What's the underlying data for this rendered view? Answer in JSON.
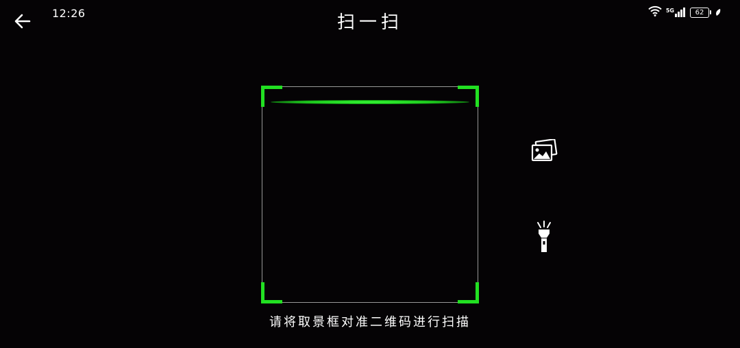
{
  "status_bar": {
    "time": "12:26",
    "network": "5G",
    "battery": "62"
  },
  "header": {
    "title": "扫一扫",
    "back_icon": "arrow-left-icon"
  },
  "scanner": {
    "hint": "请将取景框对准二维码进行扫描",
    "accent_color": "#22e022"
  },
  "actions": {
    "album_icon": "photo-album-icon",
    "flashlight_icon": "flashlight-icon"
  }
}
